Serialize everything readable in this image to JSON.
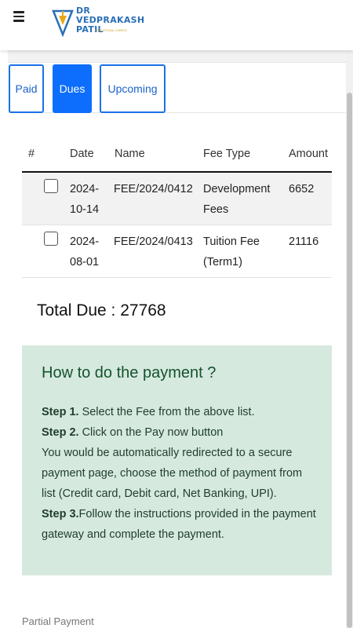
{
  "header": {
    "menu_icon": "hamburger-menu-icon",
    "logo": {
      "line1": "DR",
      "line2": "VEDPRAKASH",
      "line3": "PATIL",
      "tagline": "EDUCATIONAL CAMPUS"
    }
  },
  "tabs": [
    {
      "label": "Paid",
      "active": false
    },
    {
      "label": "Dues",
      "active": true
    },
    {
      "label": "Upcoming",
      "active": false
    }
  ],
  "table": {
    "headers": [
      "#",
      "Date",
      "Name",
      "Fee Type",
      "Amount"
    ],
    "rows": [
      {
        "date_line1": "2024-",
        "date_line2": "10-14",
        "name": "FEE/2024/0412",
        "fee_type_line1": "Development",
        "fee_type_line2": "Fees",
        "amount": "6652"
      },
      {
        "date_line1": "2024-",
        "date_line2": "08-01",
        "name": "FEE/2024/0413",
        "fee_type_line1": "Tuition Fee",
        "fee_type_line2": "(Term1)",
        "amount": "21116"
      }
    ]
  },
  "total_due": "Total Due : 27768",
  "howto": {
    "title": "How to do the payment ?",
    "step1_label": "Step 1.",
    "step1_text": " Select the Fee from the above list.",
    "step2_label": "Step 2.",
    "step2_text": " Click on the Pay now button",
    "redirect_line1": "You would be automatically redirected to a secure",
    "redirect_line2": "payment page, choose the method of payment from",
    "redirect_line3": "list (Credit card, Debit card, Net Banking, UPI).",
    "step3_label": "Step 3.",
    "step3_text": "Follow the instructions provided in the payment",
    "step3_line2": "gateway and complete the payment."
  },
  "partial_payment_label": "Partial Payment",
  "colors": {
    "primary": "#0d6efd",
    "instructions_bg": "#d6e9df",
    "instructions_title": "#14532d"
  }
}
